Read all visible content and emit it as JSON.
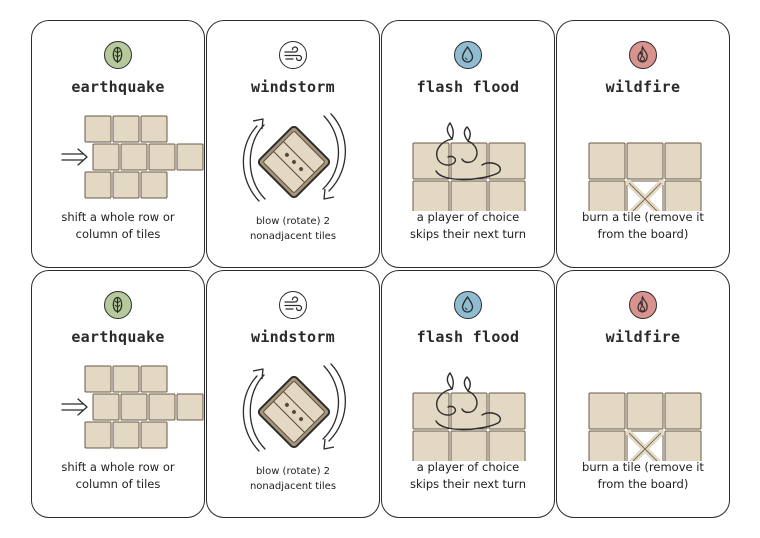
{
  "cards": [
    {
      "kind": "earthquake",
      "title": "earthquake",
      "desc": [
        "shift a whole row or",
        "column of tiles"
      ],
      "color": "#b5c99a",
      "icon": "leaf-icon"
    },
    {
      "kind": "windstorm",
      "title": "windstorm",
      "desc": [
        "blow (rotate) 2",
        "nonadjacent tiles"
      ],
      "color": "#ffffff",
      "icon": "wind-icon"
    },
    {
      "kind": "flash-flood",
      "title": "flash flood",
      "desc": [
        "a player of choice",
        "skips their next turn"
      ],
      "color": "#8fbcd1",
      "icon": "water-drop-icon"
    },
    {
      "kind": "wildfire",
      "title": "wildfire",
      "desc": [
        "burn a tile (remove it",
        "from the board)"
      ],
      "color": "#d9928e",
      "icon": "flame-icon"
    },
    {
      "kind": "earthquake",
      "title": "earthquake",
      "desc": [
        "shift a whole row or",
        "column of tiles"
      ],
      "color": "#b5c99a",
      "icon": "leaf-icon"
    },
    {
      "kind": "windstorm",
      "title": "windstorm",
      "desc": [
        "blow (rotate) 2",
        "nonadjacent tiles"
      ],
      "color": "#ffffff",
      "icon": "wind-icon"
    },
    {
      "kind": "flash-flood",
      "title": "flash flood",
      "desc": [
        "a player of choice",
        "skips their next turn"
      ],
      "color": "#8fbcd1",
      "icon": "water-drop-icon"
    },
    {
      "kind": "wildfire",
      "title": "wildfire",
      "desc": [
        "burn a tile (remove it",
        "from the board)"
      ],
      "color": "#d9928e",
      "icon": "flame-icon"
    }
  ]
}
